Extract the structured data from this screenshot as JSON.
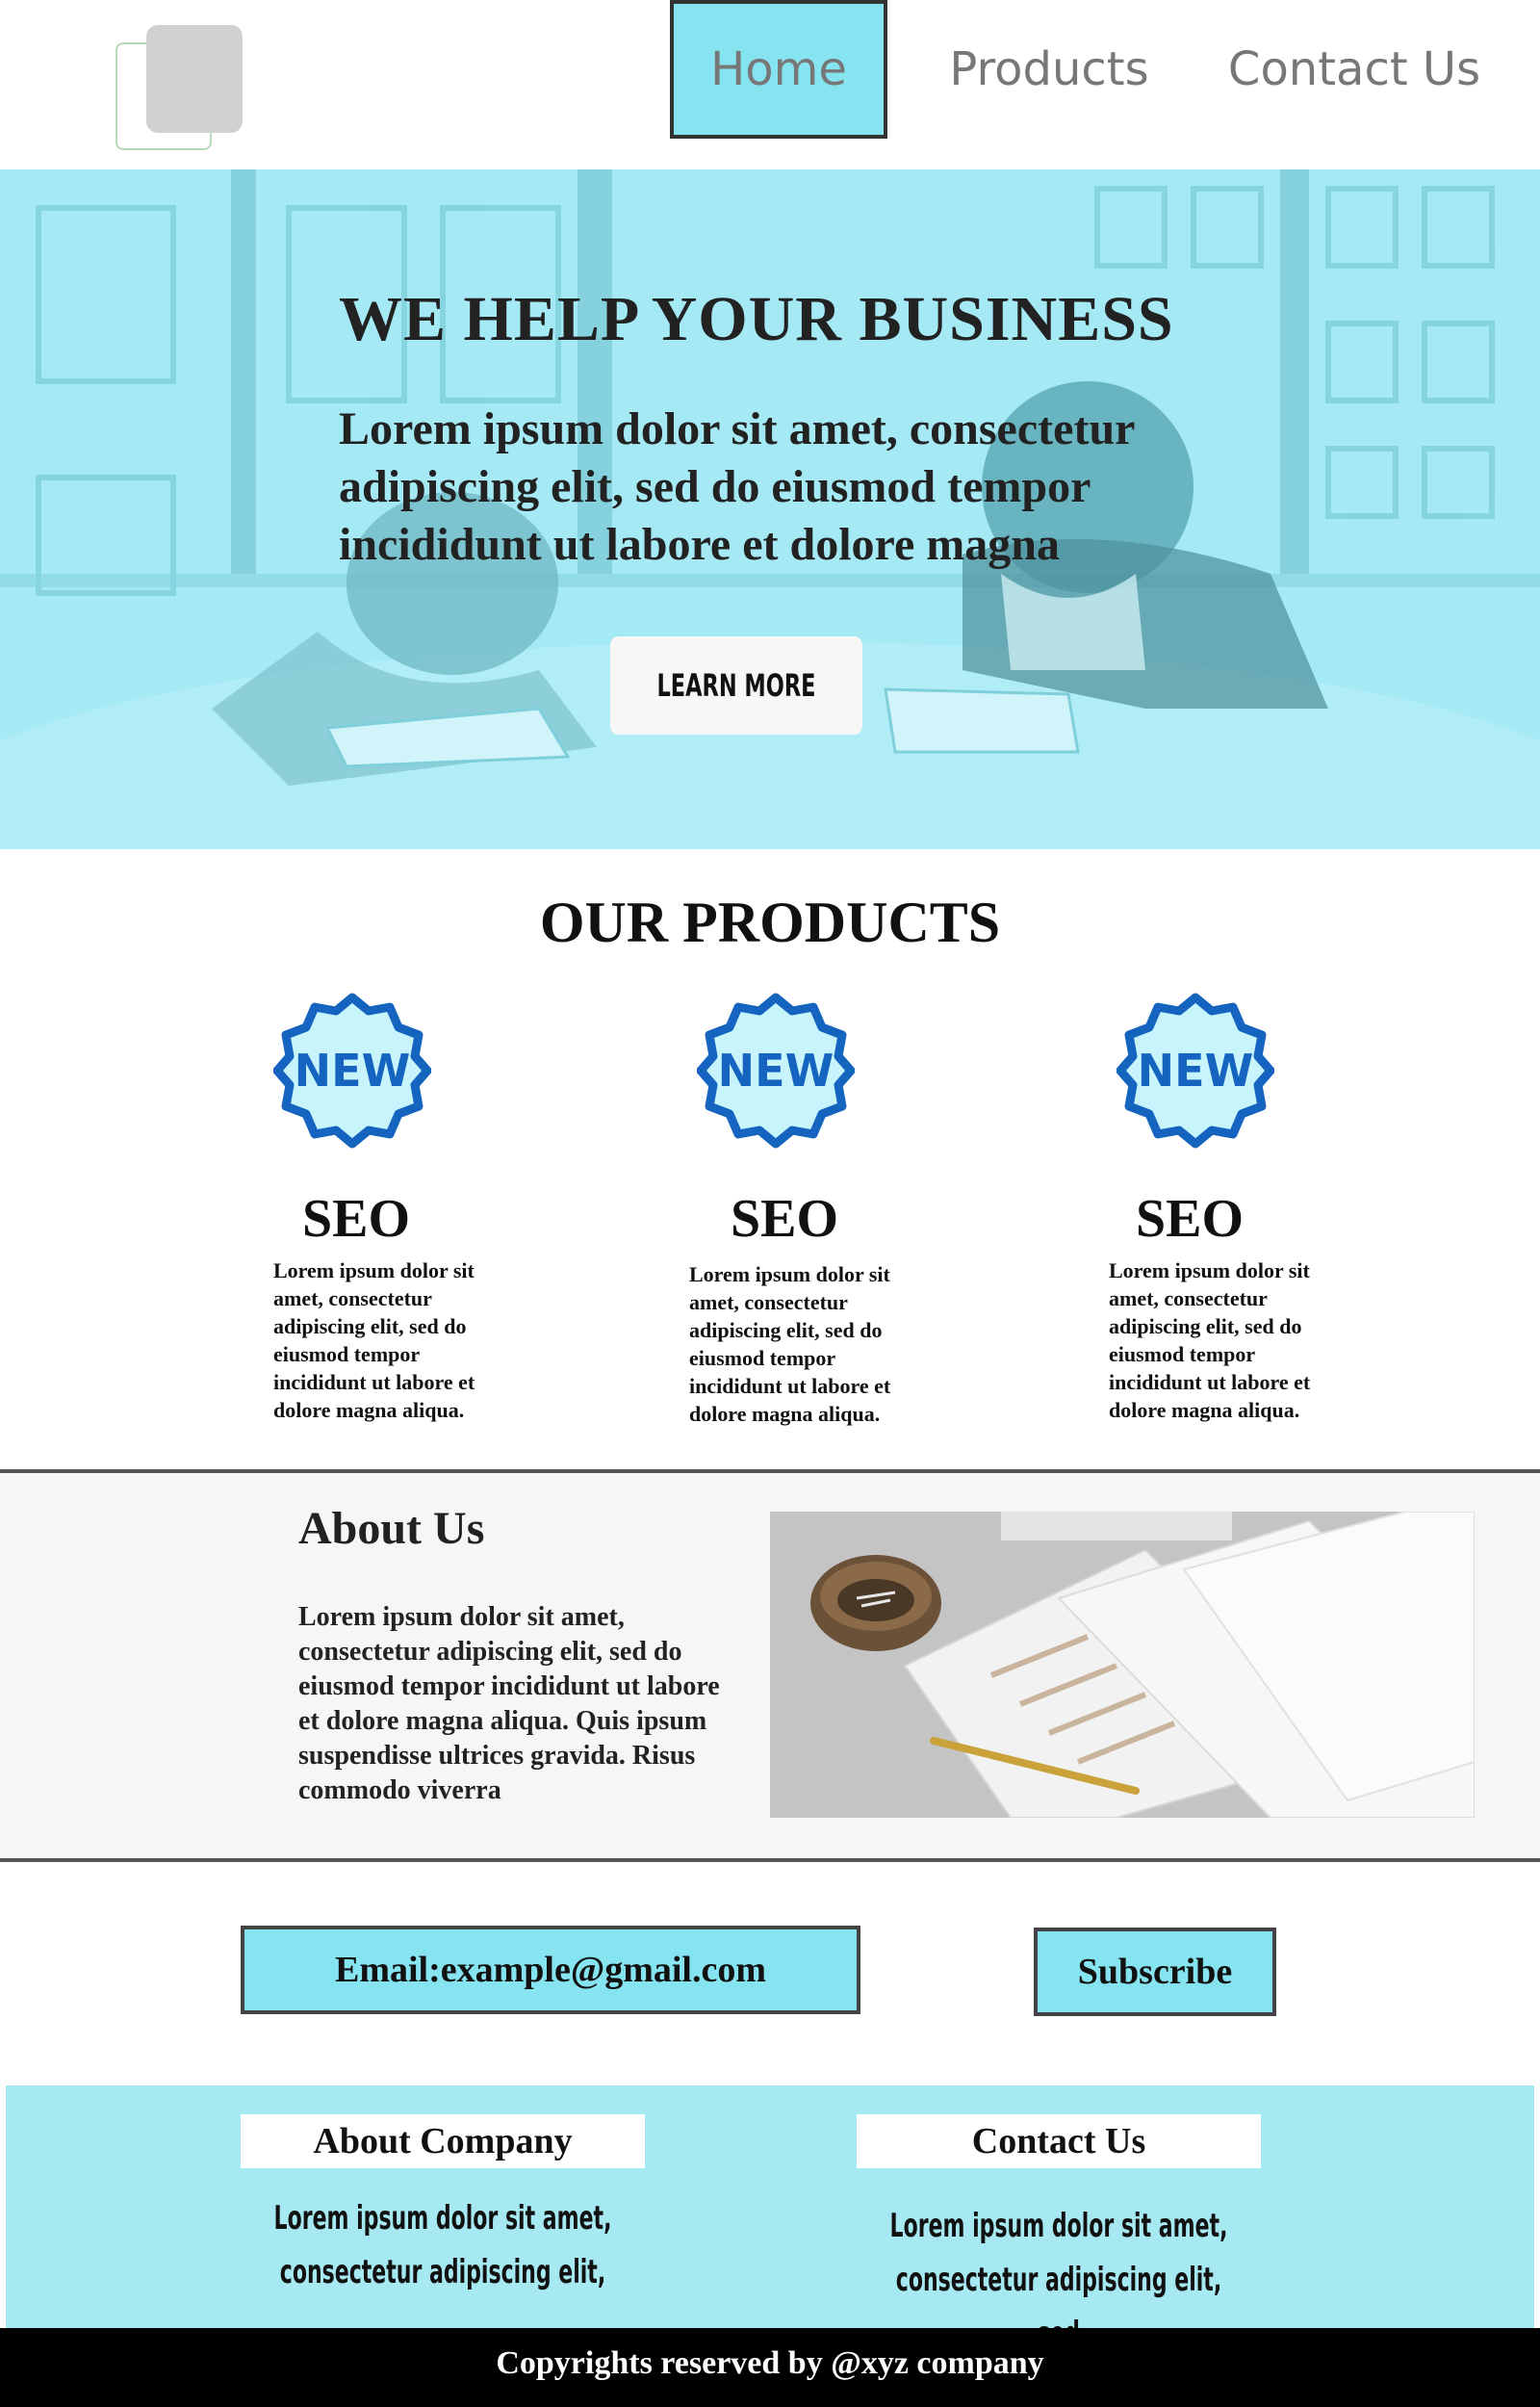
{
  "nav": {
    "items": [
      {
        "label": "Home",
        "active": true
      },
      {
        "label": "Products",
        "active": false
      },
      {
        "label": "Contact Us",
        "active": false
      }
    ]
  },
  "hero": {
    "title": "WE HELP YOUR BUSINESS",
    "text": "Lorem ipsum dolor sit amet, consectetur adipiscing elit, sed do eiusmod tempor incididunt ut labore et dolore magna",
    "button_label": "LEARN MORE"
  },
  "products": {
    "title": "OUR PRODUCTS",
    "items": [
      {
        "badge": "NEW",
        "name": "SEO",
        "desc": "Lorem ipsum dolor sit amet, consectetur adipiscing elit, sed do eiusmod tempor incididunt ut labore et dolore magna aliqua."
      },
      {
        "badge": "NEW",
        "name": "SEO",
        "desc": "Lorem ipsum dolor sit amet, consectetur adipiscing elit, sed do eiusmod tempor incididunt ut labore et dolore magna aliqua."
      },
      {
        "badge": "NEW",
        "name": "SEO",
        "desc": "Lorem ipsum dolor sit amet, consectetur adipiscing elit, sed do eiusmod tempor incididunt ut labore et dolore magna aliqua."
      }
    ]
  },
  "about": {
    "title": "About Us",
    "text": "Lorem ipsum dolor sit amet, consectetur adipiscing elit, sed do eiusmod tempor incididunt ut labore et dolore magna aliqua. Quis ipsum suspendisse ultrices gravida. Risus commodo viverra"
  },
  "subscribe": {
    "email_text": "Email:example@gmail.com",
    "button_label": "Subscribe"
  },
  "footer": {
    "about_title": "About Company",
    "about_text": "Lorem ipsum dolor sit amet, consectetur adipiscing elit,",
    "contact_title": "Contact Us",
    "contact_text": "Lorem ipsum dolor sit amet, consectetur adipiscing elit, sed",
    "copyright": "Copyrights reserved by @xyz company"
  },
  "colors": {
    "accent": "#86e3f0",
    "hero_overlay": "#9ee8f3",
    "footer_bg": "#a7e9f3",
    "badge_blue": "#1565c0",
    "badge_fill": "#c8f4fb"
  }
}
